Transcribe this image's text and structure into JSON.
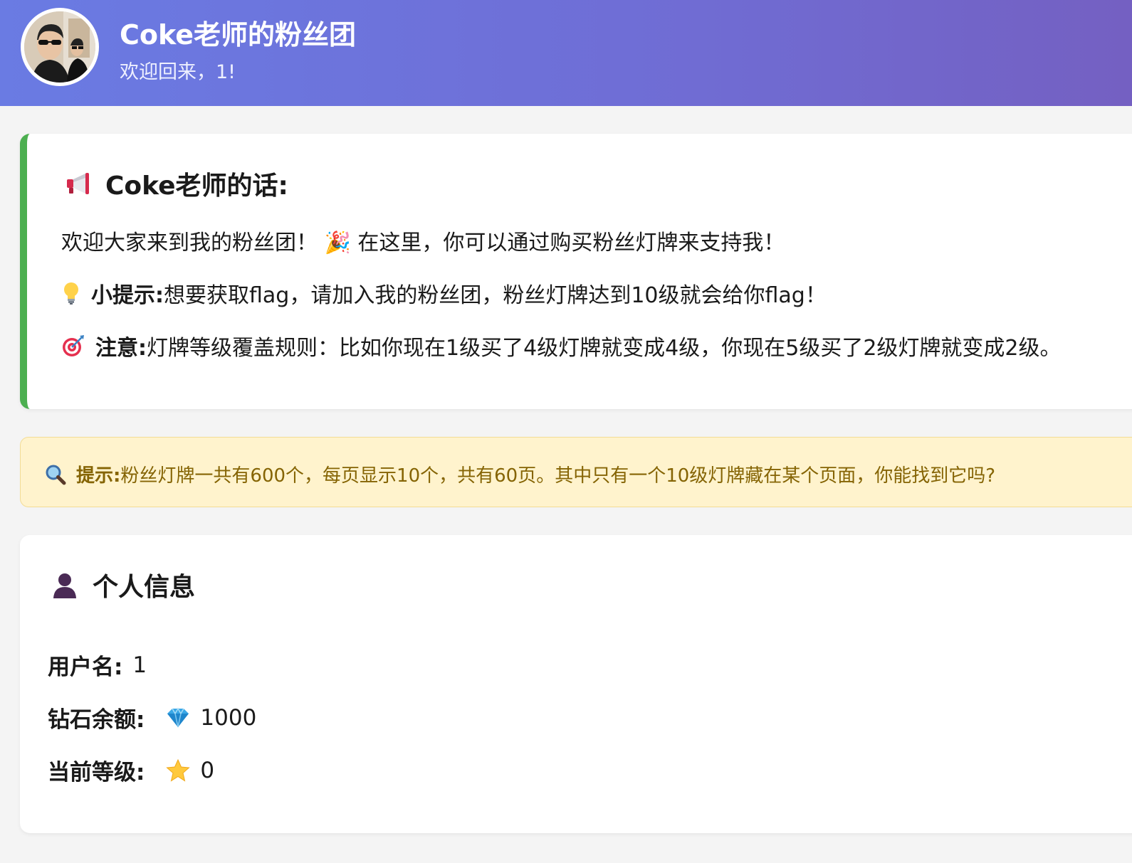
{
  "header": {
    "title": "Coke老师的粉丝团",
    "welcome": "欢迎回来，1!",
    "avatar_icon": "user-avatar-photo"
  },
  "message_card": {
    "icon": "megaphone-icon",
    "title": "Coke老师的话:",
    "line1": "欢迎大家来到我的粉丝团！ 🎉 在这里，你可以通过购买粉丝灯牌来支持我！",
    "tip_icon": "light-bulb-icon",
    "tip_label": "小提示:",
    "tip_text": "想要获取flag，请加入我的粉丝团，粉丝灯牌达到10级就会给你flag！",
    "note_icon": "target-icon",
    "note_label": "注意:",
    "note_text": "灯牌等级覆盖规则：比如你现在1级买了4级灯牌就变成4级，你现在5级买了2级灯牌就变成2级。",
    "accent_color": "#4caf50"
  },
  "hint_box": {
    "icon": "magnifier-icon",
    "label": "提示:",
    "text": "粉丝灯牌一共有600个，每页显示10个，共有60页。其中只有一个10级灯牌藏在某个页面，你能找到它吗?",
    "text_color": "#856404",
    "background": "#fff3cd"
  },
  "profile": {
    "icon": "user-silhouette-icon",
    "title": "个人信息",
    "username_label": "用户名:",
    "username_value": "1",
    "diamond_label": "钻石余额:",
    "diamond_icon": "diamond-icon",
    "diamond_value": "1000",
    "level_label": "当前等级:",
    "level_icon": "star-icon",
    "level_value": "0"
  }
}
